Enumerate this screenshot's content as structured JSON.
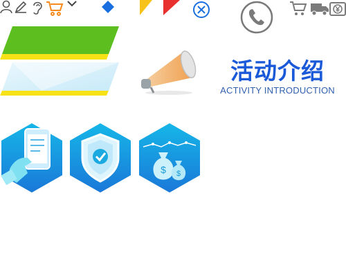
{
  "header": {
    "title_cn": "活动介绍",
    "title_en": "ACTIVITY INTRODUCTION"
  },
  "icons": {
    "top_strip": [
      "user-icon",
      "pencil-icon",
      "ear-icon",
      "cart-icon",
      "chevron-down-icon",
      "diamond-icon",
      "flag-icon",
      "close-circle-icon",
      "phone-circle-icon",
      "cart-outline-icon",
      "truck-icon",
      "yen-box-icon"
    ],
    "badges": [
      "phone-hand-icon",
      "shield-check-icon",
      "money-bags-icon"
    ]
  },
  "colors": {
    "accent_blue": "#1a5ad8",
    "green": "#5cbf1f",
    "yellow": "#f7e218",
    "orange": "#f58a1f",
    "red": "#e8312e",
    "gray": "#7a7a7a",
    "hex_blue_top": "#16b6e8",
    "hex_blue_bottom": "#1a78d8"
  }
}
